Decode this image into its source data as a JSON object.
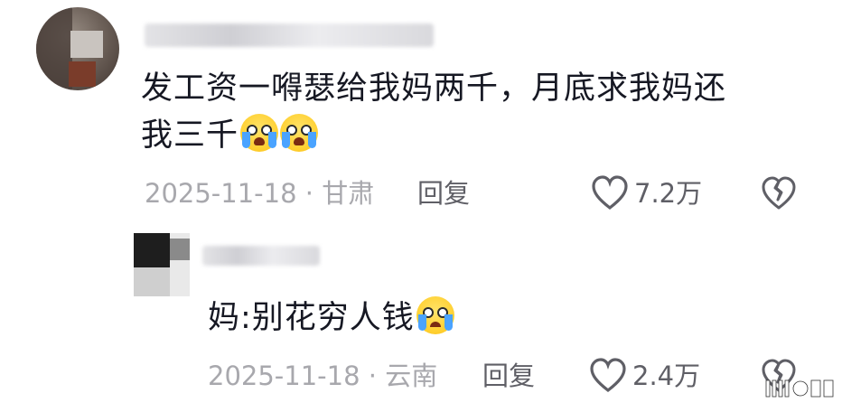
{
  "comment": {
    "text_line1": "发工资一嘚瑟给我妈两千，月底求我妈还",
    "text_line2": "我三千",
    "emoji": "crying-laughing-emoji",
    "date": "2025-11-18",
    "location": "甘肃",
    "reply_label": "回复",
    "like_count": "7.2万"
  },
  "reply": {
    "text": "妈:别花穷人钱",
    "emoji": "crying-emoji",
    "date": "2025-11-18",
    "location": "云南",
    "reply_label": "回复",
    "like_count": "2.4万"
  },
  "meta_separator": "·",
  "colors": {
    "text": "#161823",
    "meta": "#a8a8ad",
    "action": "#5f5f66"
  }
}
